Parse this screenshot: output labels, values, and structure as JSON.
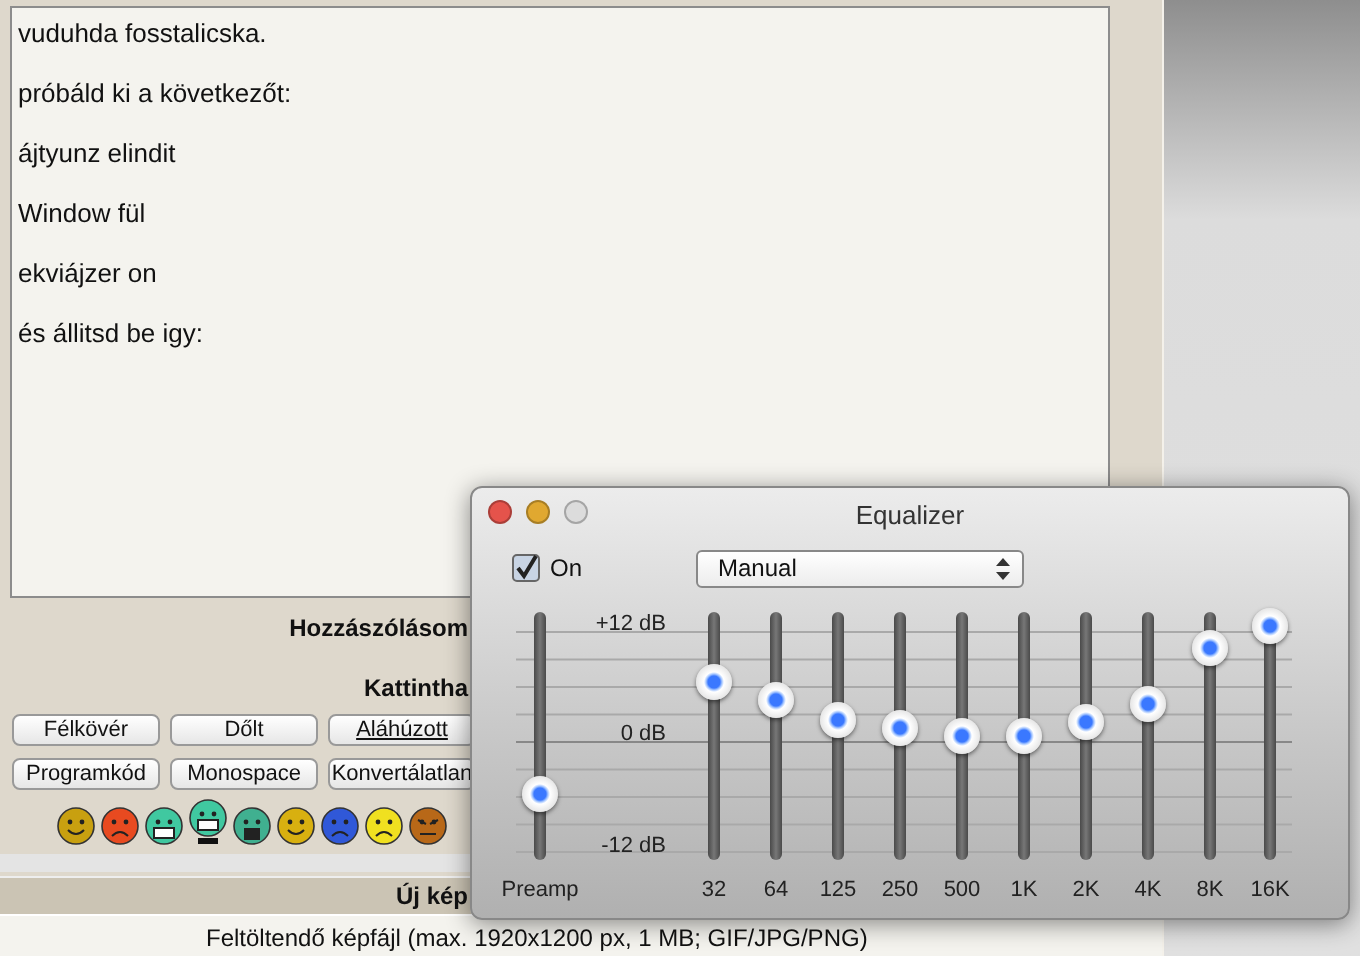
{
  "editor": {
    "lines": [
      "vuduhda fosstalicska.",
      "próbáld ki a következőt:",
      "ájtyunz elindit",
      "Window fül",
      "ekviájzer on",
      "és állitsd be igy:"
    ]
  },
  "form": {
    "heading": "Hozzászólásom",
    "clickable_heading": "Kattintha",
    "format_buttons": [
      {
        "label": "Félkövér",
        "underlined": false
      },
      {
        "label": "Dőlt",
        "underlined": false
      },
      {
        "label": "Aláhúzott",
        "underlined": true
      },
      {
        "label": "Programkód",
        "underlined": false
      },
      {
        "label": "Monospace",
        "underlined": false
      },
      {
        "label": "Konvertálatlan",
        "underlined": false
      }
    ],
    "smileys": [
      {
        "kind": "smile",
        "color": "#c8a010"
      },
      {
        "kind": "frown",
        "color": "#e84a20"
      },
      {
        "kind": "grin",
        "color": "#40c8a0"
      },
      {
        "kind": "grin_tall",
        "color": "#40c8a0"
      },
      {
        "kind": "shout",
        "color": "#40b090"
      },
      {
        "kind": "smile",
        "color": "#d8b010"
      },
      {
        "kind": "frown",
        "color": "#3058d8"
      },
      {
        "kind": "frown",
        "color": "#f0e020"
      },
      {
        "kind": "angry",
        "color": "#b86818"
      }
    ]
  },
  "upload": {
    "title": "Új kép",
    "hint": "Feltöltendő képfájl (max. 1920x1200 px, 1 MB; GIF/JPG/PNG)"
  },
  "equalizer": {
    "title": "Equalizer",
    "window_controls": [
      {
        "color": "#e5534b"
      },
      {
        "color": "#e0a830"
      },
      {
        "color": "#dcdcdc"
      }
    ],
    "on_checkbox": {
      "label": "On",
      "checked": true
    },
    "preset": {
      "value": "Manual"
    },
    "scale_labels": [
      "+12 dB",
      "0 dB",
      "-12 dB"
    ],
    "preamp": {
      "label": "Preamp",
      "level": 0.24
    },
    "bands": [
      {
        "label": "32",
        "level": 0.75
      },
      {
        "label": "64",
        "level": 0.66
      },
      {
        "label": "125",
        "level": 0.57
      },
      {
        "label": "250",
        "level": 0.54
      },
      {
        "label": "500",
        "level": 0.5
      },
      {
        "label": "1K",
        "level": 0.5
      },
      {
        "label": "2K",
        "level": 0.56
      },
      {
        "label": "4K",
        "level": 0.65
      },
      {
        "label": "8K",
        "level": 0.9
      },
      {
        "label": "16K",
        "level": 1.0
      }
    ]
  }
}
